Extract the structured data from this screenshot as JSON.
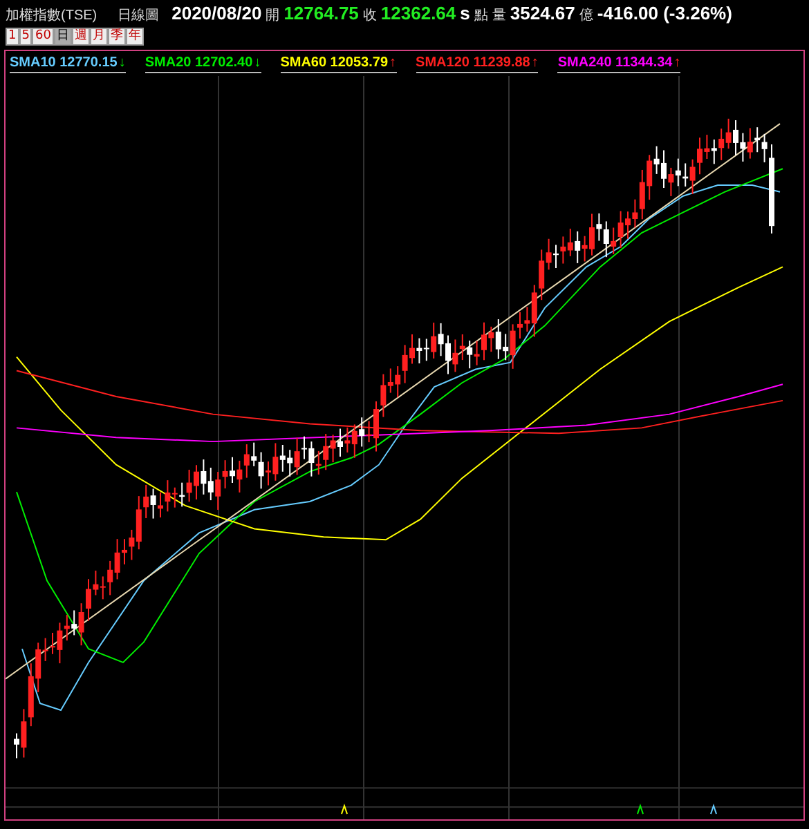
{
  "header": {
    "title": "加權指數(TSE)",
    "chart_kind": "日線圖",
    "date": "2020/08/20",
    "open_label": "開",
    "open": "12764.75",
    "close_label": "收",
    "close": "12362.64",
    "unit_mark": "s",
    "points_label": "點",
    "volume_label": "量",
    "volume": "3524.67",
    "volume_unit": "億",
    "change": "-416.00 (-3.26%)"
  },
  "periods": [
    {
      "label": "1",
      "selected": false
    },
    {
      "label": "5",
      "selected": false
    },
    {
      "label": "60",
      "selected": false
    },
    {
      "label": "日",
      "selected": true
    },
    {
      "label": "週",
      "selected": false
    },
    {
      "label": "月",
      "selected": false
    },
    {
      "label": "季",
      "selected": false
    },
    {
      "label": "年",
      "selected": false
    }
  ],
  "averages": [
    {
      "label": "SMA10 12770.15",
      "color": "#66ccff",
      "arrow": "↓",
      "kind": "falling"
    },
    {
      "label": "SMA20 12702.40",
      "color": "#00ee00",
      "arrow": "↓",
      "kind": "falling"
    },
    {
      "label": "SMA60 12053.79",
      "color": "#ffff00",
      "arrow": "↑",
      "kind": "rising"
    },
    {
      "label": "SMA120 11239.88",
      "color": "#ff2020",
      "arrow": "↑",
      "kind": "rising"
    },
    {
      "label": "SMA240 11344.34",
      "color": "#ff00ff",
      "arrow": "↑",
      "kind": "rising"
    }
  ]
}
